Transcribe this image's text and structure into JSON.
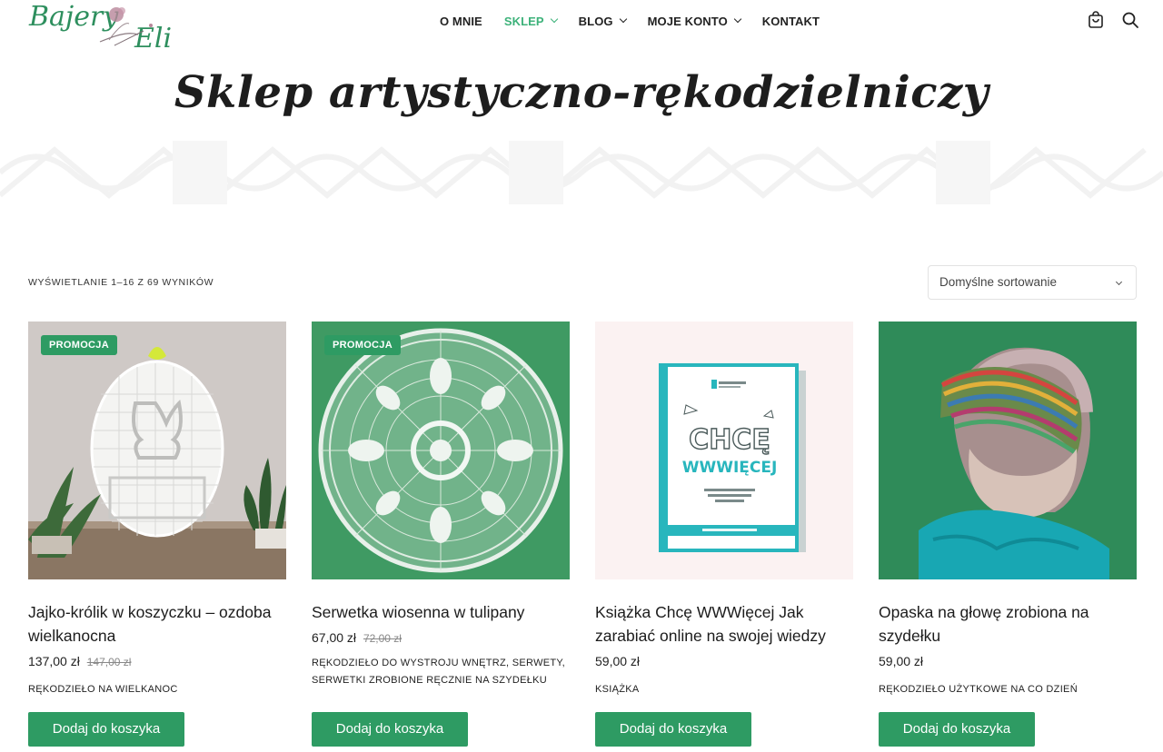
{
  "brand": {
    "line1": "Bajery",
    "line2": "Eli",
    "color": "#2e8f5e"
  },
  "nav": {
    "items": [
      {
        "label": "O MNIE"
      },
      {
        "label": "SKLEP"
      },
      {
        "label": "BLOG"
      },
      {
        "label": "MOJE KONTO"
      },
      {
        "label": "KONTAKT"
      }
    ]
  },
  "header_icons": [
    "cart-icon",
    "search-icon"
  ],
  "hero": {
    "title": "Sklep artystyczno-rękodzielniczy"
  },
  "toolbar": {
    "results": "WYŚWIETLANIE 1–16 Z 69 WYNIKÓW",
    "sort_selected": "Domyślne sortowanie"
  },
  "colors": {
    "accent": "#2e9b63",
    "nav_active": "#3db27a"
  },
  "products": [
    {
      "badge": "PROMOCJA",
      "title": "Jajko-królik w koszyczku – ozdoba wielkanocna",
      "price": "137,00 zł",
      "old_price": "147,00 zł",
      "category": "RĘKODZIEŁO NA WIELKANOC",
      "button": "Dodaj do koszyka"
    },
    {
      "badge": "PROMOCJA",
      "title": "Serwetka wiosenna w tulipany",
      "price": "67,00 zł",
      "old_price": "72,00 zł",
      "category": "RĘKODZIEŁO DO WYSTROJU WNĘTRZ, SERWETY, SERWETKI ZROBIONE RĘCZNIE NA SZYDEŁKU",
      "button": "Dodaj do koszyka"
    },
    {
      "title": "Książka Chcę WWWięcej Jak zarabiać online na swojej wiedzy",
      "price": "59,00 zł",
      "category": "KSIĄŻKA",
      "button": "Dodaj do koszyka",
      "book": {
        "title_line1": "CHCĘ",
        "title_line2": "WWWIĘCEJ"
      }
    },
    {
      "title": "Opaska na głowę zrobiona na szydełku",
      "price": "59,00 zł",
      "category": "RĘKODZIEŁO UŻYTKOWE NA CO DZIEŃ",
      "button": "Dodaj do koszyka"
    }
  ]
}
